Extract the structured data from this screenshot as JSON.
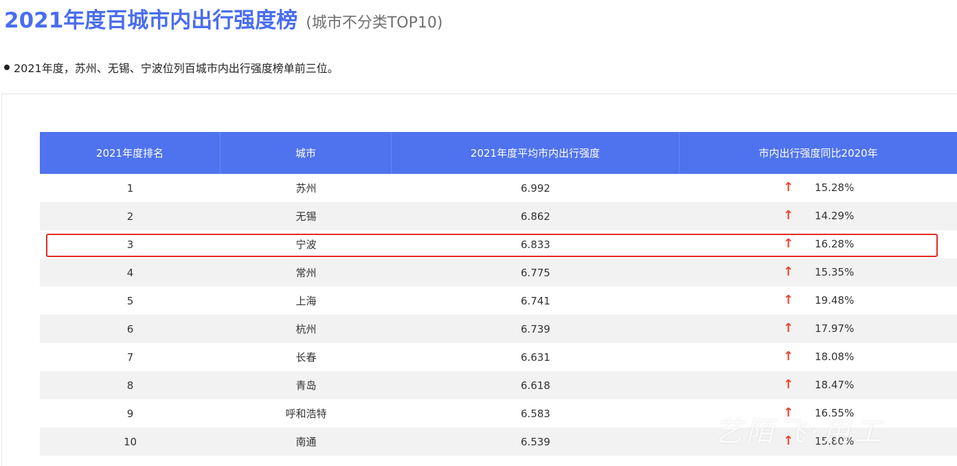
{
  "header": {
    "title": "2021年度百城市内出行强度榜",
    "subtitle": "(城市不分类TOP10)"
  },
  "note": {
    "text": "2021年度，苏州、无锡、宁波位列百城市内出行强度榜单前三位。"
  },
  "table": {
    "columns": [
      "2021年度排名",
      "城市",
      "2021年度平均市内出行强度",
      "市内出行强度同比2020年"
    ],
    "rows": [
      {
        "rank": "1",
        "city": "苏州",
        "intensity": "6.992",
        "change": "15.28%",
        "trend": "up"
      },
      {
        "rank": "2",
        "city": "无锡",
        "intensity": "6.862",
        "change": "14.29%",
        "trend": "up"
      },
      {
        "rank": "3",
        "city": "宁波",
        "intensity": "6.833",
        "change": "16.28%",
        "trend": "up"
      },
      {
        "rank": "4",
        "city": "常州",
        "intensity": "6.775",
        "change": "15.35%",
        "trend": "up"
      },
      {
        "rank": "5",
        "city": "上海",
        "intensity": "6.741",
        "change": "19.48%",
        "trend": "up"
      },
      {
        "rank": "6",
        "city": "杭州",
        "intensity": "6.739",
        "change": "17.97%",
        "trend": "up"
      },
      {
        "rank": "7",
        "city": "长春",
        "intensity": "6.631",
        "change": "18.08%",
        "trend": "up"
      },
      {
        "rank": "8",
        "city": "青岛",
        "intensity": "6.618",
        "change": "18.47%",
        "trend": "up"
      },
      {
        "rank": "9",
        "city": "呼和浩特",
        "intensity": "6.583",
        "change": "16.55%",
        "trend": "up"
      },
      {
        "rank": "10",
        "city": "南通",
        "intensity": "6.539",
        "change": "15.80%",
        "trend": "up"
      }
    ],
    "arrow_glyph": "↑",
    "highlighted_rank": "3"
  },
  "watermark": {
    "text": "艺陌飞·用工"
  },
  "colors": {
    "title": "#4a6df0",
    "header_bg": "#4f73ee",
    "arrow": "#e8412c",
    "highlight": "#e02b20",
    "stripe": "#f2f2f2"
  }
}
